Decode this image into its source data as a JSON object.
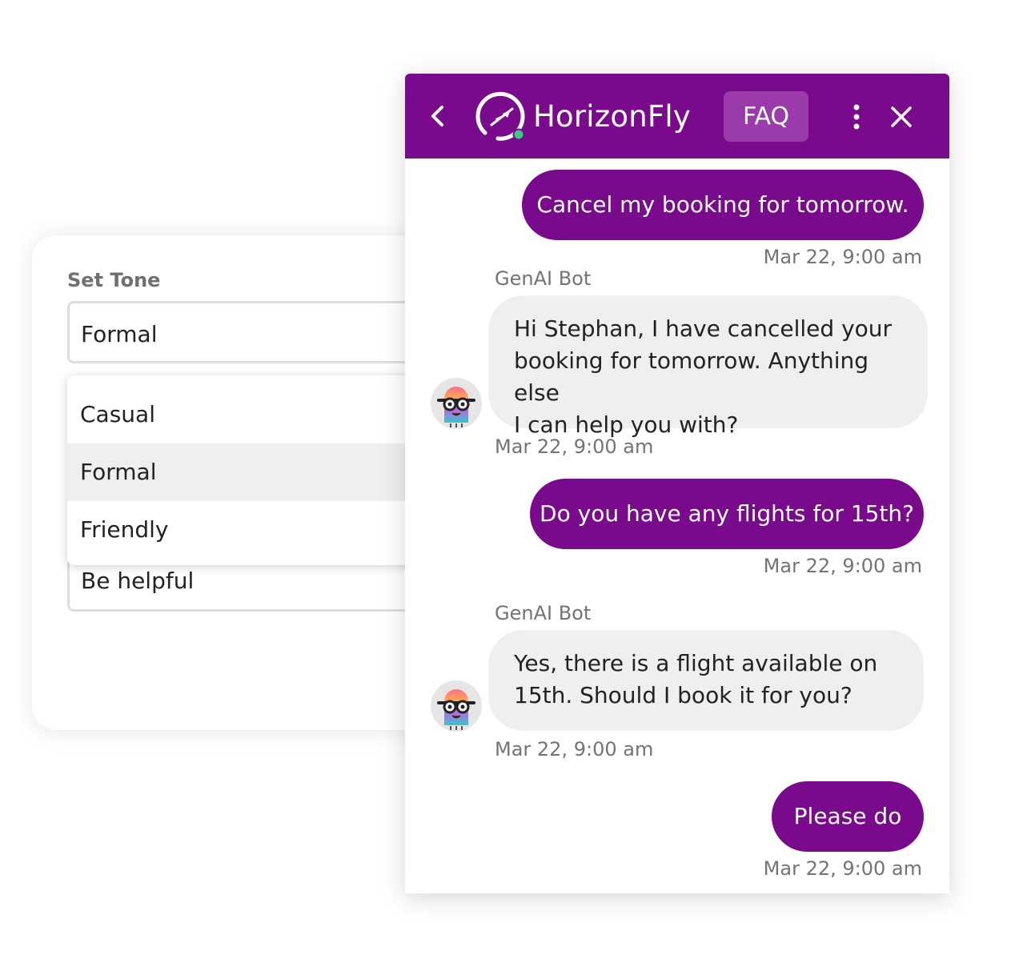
{
  "settings": {
    "tone_label": "Set Tone",
    "selected_tone": "Formal",
    "tone_options": [
      "Casual",
      "Formal",
      "Friendly"
    ],
    "instructions_value": "Be helpful"
  },
  "chat": {
    "header": {
      "brand": "HorizonFly",
      "faq_label": "FAQ"
    },
    "messages": [
      {
        "from": "user",
        "text": "Cancel my booking for tomorrow.",
        "time": "Mar 22, 9:00 am"
      },
      {
        "from": "bot",
        "sender": "GenAI Bot",
        "lines": [
          "Hi Stephan, I have cancelled your",
          "booking for tomorrow. Anything else",
          "I can help you with?"
        ],
        "time": "Mar 22, 9:00 am"
      },
      {
        "from": "user",
        "text": "Do you have any flights for 15th?",
        "time": "Mar 22, 9:00 am"
      },
      {
        "from": "bot",
        "sender": "GenAI Bot",
        "lines": [
          "Yes, there is a flight available on",
          "15th. Should I book it for you?"
        ],
        "time": "Mar 22, 9:00 am"
      },
      {
        "from": "user",
        "text": "Please do",
        "time": "Mar 22, 9:00 am"
      }
    ]
  },
  "colors": {
    "brand_purple": "#790a8c",
    "faq_button": "#9b3bab",
    "bot_bubble": "#efefef",
    "online_dot": "#3fc78a"
  }
}
